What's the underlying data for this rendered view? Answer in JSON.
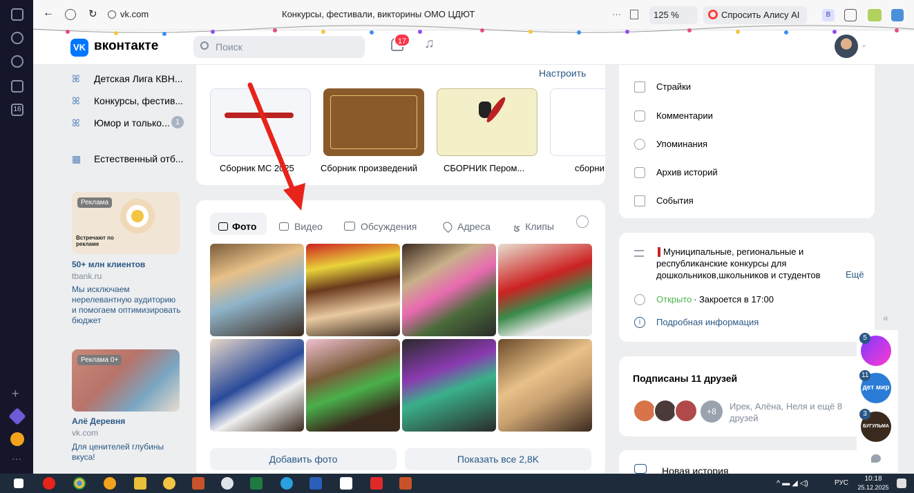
{
  "browser": {
    "address": "vk.com",
    "tab_title": "Конкурсы, фестивали, викторины ОМО ЦДЮТ",
    "zoom": "125 %",
    "alice_button": "Спросить Алису AI",
    "rail_badge": "16"
  },
  "header": {
    "logo_text": "вконтакте",
    "search_placeholder": "Поиск",
    "notifications_count": "17"
  },
  "left_nav": {
    "items": [
      {
        "label": "Детская Лига КВН..."
      },
      {
        "label": "Конкурсы, фестив..."
      },
      {
        "label": "Юмор и только...",
        "badge": "1"
      },
      {
        "label": "Естественный отб..."
      }
    ]
  },
  "ads": [
    {
      "badge": "Реклама",
      "image_text": "Встречают по рекламе",
      "title": "50+ млн клиентов",
      "domain": "tbank.ru",
      "desc": "Мы исключаем нерелевантную аудиторию и помогаем оптимизировать бюджет"
    },
    {
      "badge": "Реклама 0+",
      "title": "Алё Деревня",
      "domain": "vk.com",
      "desc": "Для ценителей глубины вкуса!"
    }
  ],
  "articles": {
    "configure_label": "Настроить",
    "items": [
      {
        "caption": "Сборник МС 2025",
        "color": "#f4f6fa"
      },
      {
        "caption": "Сборник произведений",
        "color": "#8a5a2b"
      },
      {
        "caption": "СБОРНИК Пером...",
        "color": "#f3efc9"
      },
      {
        "caption": "сборни",
        "color": "#ffffff"
      }
    ]
  },
  "media": {
    "tabs": [
      {
        "label": "Фото",
        "active": true
      },
      {
        "label": "Видео"
      },
      {
        "label": "Обсуждения"
      },
      {
        "label": "Адреса"
      },
      {
        "label": "Клипы"
      }
    ],
    "add_photo_label": "Добавить фото",
    "show_all_label": "Показать все 2,8K"
  },
  "right_menu": {
    "items": [
      {
        "label": "Страйки",
        "icon": "warning-icon"
      },
      {
        "label": "Комментарии",
        "icon": "comment-icon"
      },
      {
        "label": "Упоминания",
        "icon": "at-icon"
      },
      {
        "label": "Архив историй",
        "icon": "archive-icon"
      },
      {
        "label": "События",
        "icon": "calendar-icon"
      }
    ]
  },
  "info": {
    "description": "Муниципальные, региональные и республиканские конкурсы для дошкольников,школьников и студентов",
    "more_label": "Ещё",
    "open_label": "Открыто",
    "closes_label": "· Закроется в 17:00",
    "details_label": "Подробная информация"
  },
  "friends": {
    "title": "Подписаны 11 друзей",
    "extra_count": "+8",
    "names": "Ирек, Алёна, Неля и ещё 8 друзей"
  },
  "bottom_partial": "Новая история",
  "side_widgets": {
    "chat1_count": "5",
    "chat2_count": "11",
    "chat2_text": "дет мир",
    "chat3_count": "3",
    "chat3_text": "БУГУЛЬМА"
  },
  "taskbar": {
    "lang": "РУС",
    "time": "10:18",
    "date": "25.12.2025"
  },
  "colors": {
    "accent": "#0077ff",
    "link": "#2a5885",
    "open_green": "#4bb34b",
    "notify_red": "#ff3347",
    "arrow_red": "#e8231a"
  }
}
